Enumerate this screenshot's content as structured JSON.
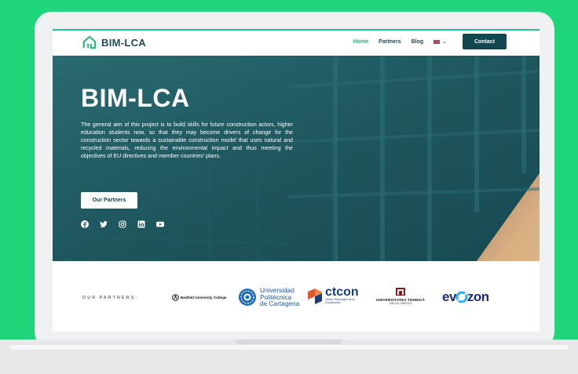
{
  "brand": {
    "name": "BIM-LCA"
  },
  "nav": {
    "links": [
      "Home",
      "Partners",
      "Blog"
    ],
    "contact": "Contact"
  },
  "hero": {
    "title": "BIM-LCA",
    "description": "The general aim of this project is to build skills for future construction actors, higher education students now, so that they may become drivers of change for the construction sector towards a sustainable construction model that uses natural and recycled materials, reducing the environmental impact and thus meeting the objectives of EU directives and member countries' plans.",
    "button": "Our Partners",
    "social_icons": [
      "facebook-icon",
      "twitter-icon",
      "instagram-icon",
      "linkedin-icon",
      "youtube-icon"
    ]
  },
  "partners": {
    "label": "OUR PARTNERS:",
    "bedfordText": "Bedfold University College",
    "upct": [
      "Universidad",
      "Politécnica",
      "de Cartagena"
    ],
    "ctcon": {
      "name": "ctcon",
      "sub1": "Centro Tecnológico de la",
      "sub2": "Construcción"
    },
    "utcn": {
      "name": "UNIVERSITATEA TEHNICĂ",
      "sub": "DIN CLUJ-NAPOCA"
    },
    "evozon": {
      "ev": "ev",
      "zon": "zon"
    }
  },
  "colors": {
    "background": "#1fd67a",
    "accent": "#22b573",
    "dark": "#124750",
    "hero": "#1f5a62"
  }
}
